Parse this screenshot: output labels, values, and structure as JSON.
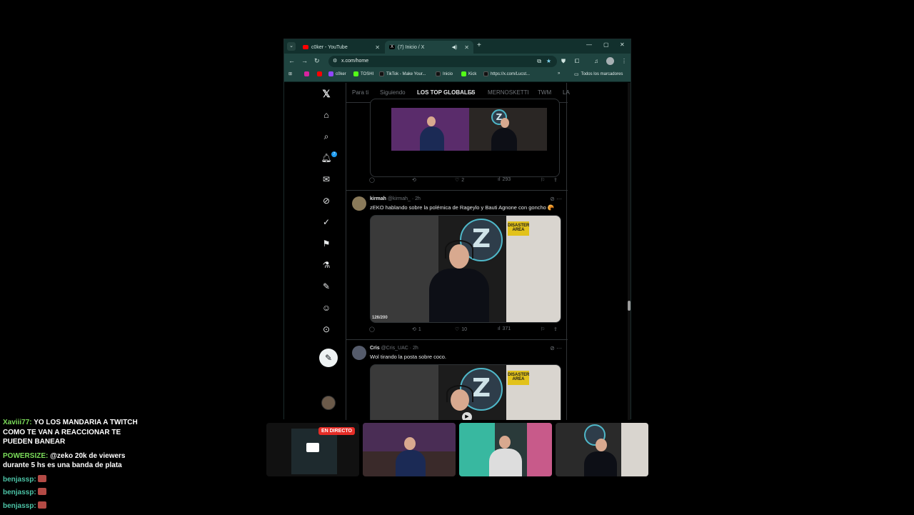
{
  "browser": {
    "tabs": [
      {
        "label": "c0ker - YouTube",
        "favicon": "youtube-icon",
        "active": false
      },
      {
        "label": "(7) Inicio / X",
        "favicon": "x-icon",
        "active": true
      }
    ],
    "url": "x.com/home",
    "bookmarks": [
      {
        "label": "",
        "icon": "instagram-icon",
        "color": "#d6249f"
      },
      {
        "label": "",
        "icon": "youtube-icon",
        "color": "#ff0000"
      },
      {
        "label": "c0ker",
        "icon": "twitch-icon",
        "color": "#9146ff"
      },
      {
        "label": "TOSHI",
        "icon": "kick-icon",
        "color": "#53fc18"
      },
      {
        "label": "TikTok - Make Your...",
        "icon": "tiktok-icon",
        "color": "#000000"
      },
      {
        "label": "Inicio",
        "icon": "x-icon",
        "color": "#000000"
      },
      {
        "label": "Kick",
        "icon": "kick-icon",
        "color": "#53fc18"
      },
      {
        "label": "https://x.com/Lucst...",
        "icon": "x-icon",
        "color": "#000000"
      }
    ],
    "all_bookmarks": "Todos los marcadores"
  },
  "x": {
    "feed_tabs": [
      "Para ti",
      "Siguiendo",
      "LOS TOP GLOBALES",
      "MERNOSKETTI",
      "TWM",
      "LA"
    ],
    "notifications_badge": "7",
    "tweet0_actions": {
      "replies": "",
      "retweets": "",
      "likes": "2",
      "views": "293"
    },
    "tweet1": {
      "name": "kirmah",
      "handle": "@kirmah_",
      "time": "· 2h",
      "text": "zEKO hablando sobre la polémica de Rageylo y Bauti Agnone con goncho 🥐",
      "video_counter": "126/200",
      "sign": "DISASTER AREA",
      "actions": {
        "replies": "",
        "retweets": "1",
        "likes": "10",
        "views": "371"
      }
    },
    "tweet2": {
      "name": "Cris",
      "handle": "@Cris_UAC",
      "time": "· 2h",
      "text": "Wol tirando la posta sobre coco.",
      "sign": "DISASTER AREA"
    }
  },
  "chat": [
    {
      "user": "Xaviii77:",
      "user_color": "#7bdd5a",
      "text": "YO LOS MANDARIA A TWITCH COMO TE VAN A REACCIONAR TE PUEDEN BANEAR",
      "emote": false
    },
    {
      "user": "POWERSIZE:",
      "user_color": "#7bdd5a",
      "text": "@zeko 20k de viewers durante 5 hs es una banda de plata",
      "emote": false
    },
    {
      "user": "benjassp:",
      "user_color": "#4cc3a6",
      "text": "",
      "emote": true
    },
    {
      "user": "benjassp:",
      "user_color": "#4cc3a6",
      "text": "",
      "emote": true
    },
    {
      "user": "benjassp:",
      "user_color": "#4cc3a6",
      "text": "",
      "emote": true
    }
  ],
  "streams": {
    "live_label": "EN DIRECTO"
  }
}
